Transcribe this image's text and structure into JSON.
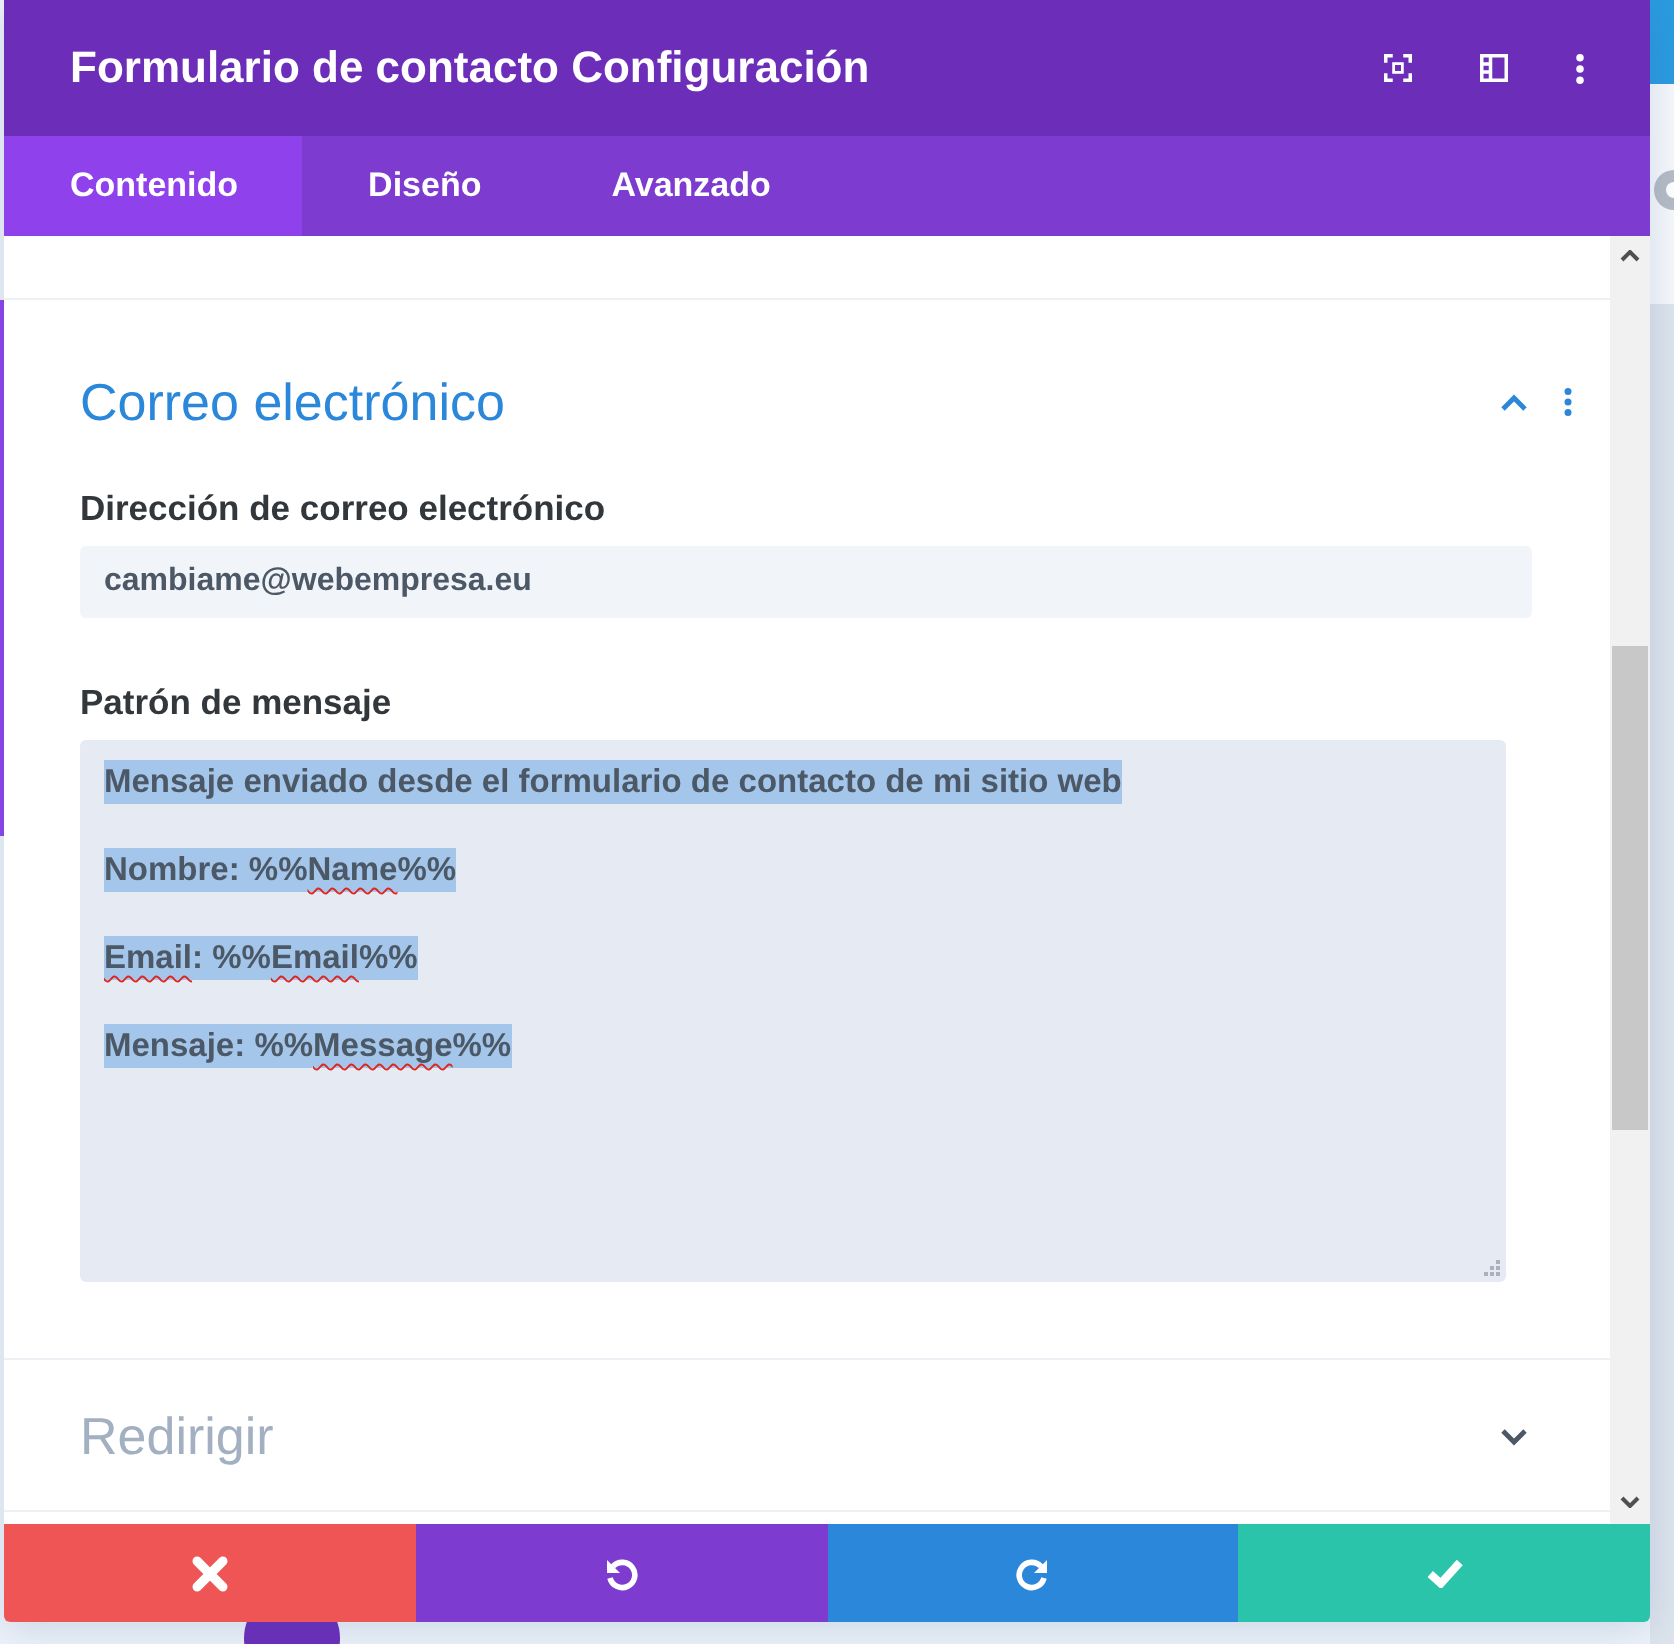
{
  "window": {
    "title": "Formulario de contacto Configuración",
    "header_icons": [
      {
        "kind": "fullscreen"
      },
      {
        "kind": "layout"
      },
      {
        "kind": "more"
      }
    ]
  },
  "tabs": [
    {
      "label": "Contenido",
      "selected": true
    },
    {
      "label": "Diseño",
      "selected": false
    },
    {
      "label": "Avanzado",
      "selected": false
    }
  ],
  "sections": [
    {
      "title": "Correo electrónico",
      "expanded": true,
      "fields": [
        {
          "kind": "text",
          "label": "Dirección de correo electrónico",
          "value": "cambiame@webempresa.eu"
        },
        {
          "kind": "textarea",
          "label": "Patrón de mensaje",
          "text_selected": true,
          "lines": [
            {
              "segments": [
                {
                  "text": "Mensaje enviado desde el formulario de contacto de mi sitio web",
                  "misspelled": false
                }
              ]
            },
            {
              "segments": [
                {
                  "text": "Nombre: %%",
                  "misspelled": false
                },
                {
                  "text": "Name",
                  "misspelled": true
                },
                {
                  "text": "%%",
                  "misspelled": false
                }
              ]
            },
            {
              "segments": [
                {
                  "text": "Email",
                  "misspelled": true
                },
                {
                  "text": ": %%",
                  "misspelled": false
                },
                {
                  "text": "Email",
                  "misspelled": true
                },
                {
                  "text": "%%",
                  "misspelled": false
                }
              ]
            },
            {
              "segments": [
                {
                  "text": "Mensaje: %%",
                  "misspelled": false
                },
                {
                  "text": "Message",
                  "misspelled": true
                },
                {
                  "text": "%%",
                  "misspelled": false
                }
              ]
            }
          ]
        }
      ]
    },
    {
      "title": "Redirigir",
      "expanded": false
    }
  ],
  "footer_buttons": [
    {
      "kind": "cancel"
    },
    {
      "kind": "undo"
    },
    {
      "kind": "redo"
    },
    {
      "kind": "save"
    }
  ]
}
